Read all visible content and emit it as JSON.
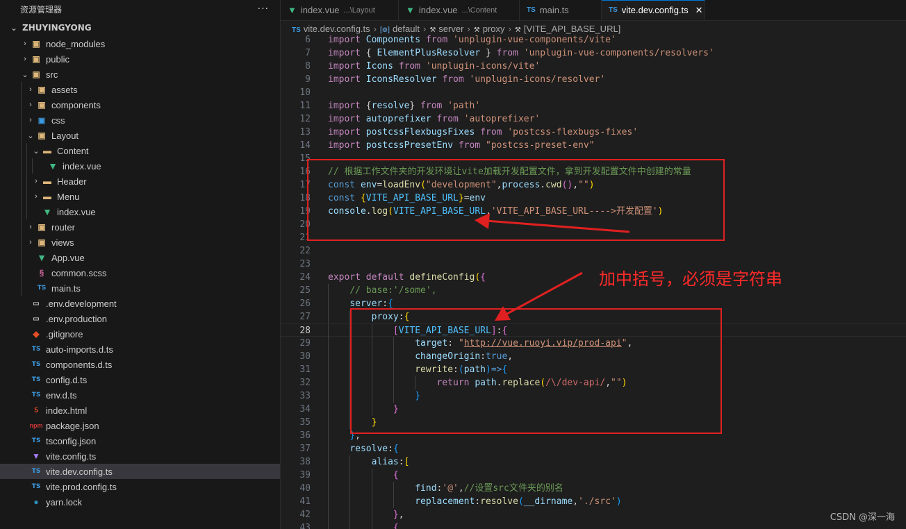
{
  "explorer": {
    "title": "资源管理器",
    "more": "···",
    "root": "ZHUYINGYONG",
    "items": [
      {
        "label": "node_modules",
        "depth": 1,
        "chev": "›",
        "icon": "node-modules-folder-icon",
        "glyph": "▣",
        "kind": "folder"
      },
      {
        "label": "public",
        "depth": 1,
        "chev": "›",
        "icon": "public-folder-icon",
        "glyph": "▣",
        "kind": "folder"
      },
      {
        "label": "src",
        "depth": 1,
        "chev": "⌄",
        "icon": "src-folder-icon",
        "glyph": "▣",
        "kind": "folder"
      },
      {
        "label": "assets",
        "depth": 2,
        "chev": "›",
        "icon": "assets-folder-icon",
        "glyph": "▣",
        "kind": "folder"
      },
      {
        "label": "components",
        "depth": 2,
        "chev": "›",
        "icon": "components-folder-icon",
        "glyph": "▣",
        "kind": "folder"
      },
      {
        "label": "css",
        "depth": 2,
        "chev": "›",
        "icon": "css-folder-icon",
        "glyph": "▣",
        "kind": "css"
      },
      {
        "label": "Layout",
        "depth": 2,
        "chev": "⌄",
        "icon": "layout-folder-icon",
        "glyph": "▣",
        "kind": "folder"
      },
      {
        "label": "Content",
        "depth": 3,
        "chev": "⌄",
        "icon": "content-folder-icon",
        "glyph": "▬",
        "kind": "folder"
      },
      {
        "label": "index.vue",
        "depth": 4,
        "chev": "",
        "icon": "vue-file-icon",
        "glyph": "▼",
        "kind": "vue"
      },
      {
        "label": "Header",
        "depth": 3,
        "chev": "›",
        "icon": "header-folder-icon",
        "glyph": "▬",
        "kind": "folder"
      },
      {
        "label": "Menu",
        "depth": 3,
        "chev": "›",
        "icon": "menu-folder-icon",
        "glyph": "▬",
        "kind": "folder"
      },
      {
        "label": "index.vue",
        "depth": 3,
        "chev": "",
        "icon": "vue-file-icon",
        "glyph": "▼",
        "kind": "vue"
      },
      {
        "label": "router",
        "depth": 2,
        "chev": "›",
        "icon": "router-folder-icon",
        "glyph": "▣",
        "kind": "folder"
      },
      {
        "label": "views",
        "depth": 2,
        "chev": "›",
        "icon": "views-folder-icon",
        "glyph": "▣",
        "kind": "folder"
      },
      {
        "label": "App.vue",
        "depth": 2,
        "chev": "",
        "icon": "vue-file-icon",
        "glyph": "▼",
        "kind": "vue"
      },
      {
        "label": "common.scss",
        "depth": 2,
        "chev": "",
        "icon": "scss-file-icon",
        "glyph": "§",
        "kind": "scss"
      },
      {
        "label": "main.ts",
        "depth": 2,
        "chev": "",
        "icon": "ts-file-icon",
        "glyph": "TS",
        "kind": "ts"
      },
      {
        "label": ".env.development",
        "depth": 1,
        "chev": "",
        "icon": "env-file-icon",
        "glyph": "▭",
        "kind": "env"
      },
      {
        "label": ".env.production",
        "depth": 1,
        "chev": "",
        "icon": "env-file-icon",
        "glyph": "▭",
        "kind": "env"
      },
      {
        "label": ".gitignore",
        "depth": 1,
        "chev": "",
        "icon": "git-file-icon",
        "glyph": "◆",
        "kind": "git"
      },
      {
        "label": "auto-imports.d.ts",
        "depth": 1,
        "chev": "",
        "icon": "ts-file-icon",
        "glyph": "TS",
        "kind": "ts"
      },
      {
        "label": "components.d.ts",
        "depth": 1,
        "chev": "",
        "icon": "ts-file-icon",
        "glyph": "TS",
        "kind": "ts"
      },
      {
        "label": "config.d.ts",
        "depth": 1,
        "chev": "",
        "icon": "ts-file-icon",
        "glyph": "TS",
        "kind": "ts"
      },
      {
        "label": "env.d.ts",
        "depth": 1,
        "chev": "",
        "icon": "ts-file-icon",
        "glyph": "TS",
        "kind": "ts"
      },
      {
        "label": "index.html",
        "depth": 1,
        "chev": "",
        "icon": "html-file-icon",
        "glyph": "5",
        "kind": "html"
      },
      {
        "label": "package.json",
        "depth": 1,
        "chev": "",
        "icon": "npm-file-icon",
        "glyph": "npm",
        "kind": "json"
      },
      {
        "label": "tsconfig.json",
        "depth": 1,
        "chev": "",
        "icon": "tsconfig-file-icon",
        "glyph": "TS",
        "kind": "ts"
      },
      {
        "label": "vite.config.ts",
        "depth": 1,
        "chev": "",
        "icon": "vite-file-icon",
        "glyph": "▼",
        "kind": "vite"
      },
      {
        "label": "vite.dev.config.ts",
        "depth": 1,
        "chev": "",
        "icon": "ts-file-icon",
        "glyph": "TS",
        "kind": "ts",
        "selected": true
      },
      {
        "label": "vite.prod.config.ts",
        "depth": 1,
        "chev": "",
        "icon": "ts-file-icon",
        "glyph": "TS",
        "kind": "ts"
      },
      {
        "label": "yarn.lock",
        "depth": 1,
        "chev": "",
        "icon": "yarn-file-icon",
        "glyph": "●",
        "kind": "yarn"
      }
    ]
  },
  "tabs": [
    {
      "label": "index.vue",
      "desc": "...\\Layout",
      "kind": "vue",
      "glyph": "▼"
    },
    {
      "label": "index.vue",
      "desc": "...\\Content",
      "kind": "vue",
      "glyph": "▼"
    },
    {
      "label": "main.ts",
      "desc": "",
      "kind": "ts",
      "glyph": "TS"
    },
    {
      "label": "vite.dev.config.ts",
      "desc": "",
      "kind": "ts",
      "glyph": "TS",
      "active": true,
      "close": "✕"
    }
  ],
  "breadcrumb": [
    {
      "label": "vite.dev.config.ts",
      "glyph": "TS",
      "kind": "ts"
    },
    {
      "label": "default",
      "glyph": "[⊚]",
      "kind": "sym"
    },
    {
      "label": "server",
      "glyph": "⚒",
      "kind": "wr"
    },
    {
      "label": "proxy",
      "glyph": "⚒",
      "kind": "wr"
    },
    {
      "label": "[VITE_API_BASE_URL]",
      "glyph": "⚒",
      "kind": "wr"
    }
  ],
  "code_lines": [
    {
      "n": 6,
      "t": [
        [
          "kw",
          "import "
        ],
        [
          "var",
          "Components "
        ],
        [
          "kw",
          "from "
        ],
        [
          "str",
          "'unplugin-vue-components/vite'"
        ]
      ]
    },
    {
      "n": 7,
      "t": [
        [
          "kw",
          "import "
        ],
        [
          "pl",
          "{ "
        ],
        [
          "var",
          "ElementPlusResolver "
        ],
        [
          "pl",
          "} "
        ],
        [
          "kw",
          "from "
        ],
        [
          "str",
          "'unplugin-vue-components/resolvers'"
        ]
      ]
    },
    {
      "n": 8,
      "t": [
        [
          "kw",
          "import "
        ],
        [
          "var",
          "Icons "
        ],
        [
          "kw",
          "from "
        ],
        [
          "str",
          "'unplugin-icons/vite'"
        ]
      ]
    },
    {
      "n": 9,
      "t": [
        [
          "kw",
          "import "
        ],
        [
          "var",
          "IconsResolver "
        ],
        [
          "kw",
          "from "
        ],
        [
          "str",
          "'unplugin-icons/resolver'"
        ]
      ]
    },
    {
      "n": 10,
      "t": []
    },
    {
      "n": 11,
      "t": [
        [
          "kw",
          "import "
        ],
        [
          "pl",
          "{"
        ],
        [
          "var",
          "resolve"
        ],
        [
          "pl",
          "} "
        ],
        [
          "kw",
          "from "
        ],
        [
          "str",
          "'path'"
        ]
      ]
    },
    {
      "n": 12,
      "t": [
        [
          "kw",
          "import "
        ],
        [
          "var",
          "autoprefixer "
        ],
        [
          "kw",
          "from "
        ],
        [
          "str",
          "'autoprefixer'"
        ]
      ]
    },
    {
      "n": 13,
      "t": [
        [
          "kw",
          "import "
        ],
        [
          "var",
          "postcssFlexbugsFixes "
        ],
        [
          "kw",
          "from "
        ],
        [
          "str",
          "'postcss-flexbugs-fixes'"
        ]
      ]
    },
    {
      "n": 14,
      "t": [
        [
          "kw",
          "import "
        ],
        [
          "var",
          "postcssPresetEnv "
        ],
        [
          "kw",
          "from "
        ],
        [
          "str",
          "\"postcss-preset-env\""
        ]
      ]
    },
    {
      "n": 15,
      "t": []
    },
    {
      "n": 16,
      "t": [
        [
          "cm",
          "// 根据工作文件夹的开发环境让vite加载开发配置文件，拿到开发配置文件中创建的常量"
        ]
      ]
    },
    {
      "n": 17,
      "t": [
        [
          "dk",
          "const "
        ],
        [
          "var",
          "env"
        ],
        [
          "pl",
          "="
        ],
        [
          "fn",
          "loadEnv"
        ],
        [
          "br1",
          "("
        ],
        [
          "str",
          "\"development\""
        ],
        [
          "pl",
          ","
        ],
        [
          "var",
          "process"
        ],
        [
          "pl",
          "."
        ],
        [
          "fn",
          "cwd"
        ],
        [
          "br2",
          "()"
        ],
        [
          "pl",
          ","
        ],
        [
          "str",
          "\"\""
        ],
        [
          "br1",
          ")"
        ]
      ]
    },
    {
      "n": 18,
      "t": [
        [
          "dk",
          "const "
        ],
        [
          "br1",
          "{"
        ],
        [
          "cn",
          "VITE_API_BASE_URL"
        ],
        [
          "br1",
          "}"
        ],
        [
          "pl",
          "="
        ],
        [
          "var",
          "env"
        ]
      ]
    },
    {
      "n": 19,
      "t": [
        [
          "var",
          "console"
        ],
        [
          "pl",
          "."
        ],
        [
          "fn",
          "log"
        ],
        [
          "br1",
          "("
        ],
        [
          "cn",
          "VITE_API_BASE_URL"
        ],
        [
          "pl",
          ","
        ],
        [
          "str",
          "'VITE_API_BASE_URL---->开发配置'"
        ],
        [
          "br1",
          ")"
        ]
      ]
    },
    {
      "n": 20,
      "t": []
    },
    {
      "n": 21,
      "t": []
    },
    {
      "n": 22,
      "t": []
    },
    {
      "n": 23,
      "t": []
    },
    {
      "n": 24,
      "t": [
        [
          "kw",
          "export "
        ],
        [
          "kw",
          "default "
        ],
        [
          "fn",
          "defineConfig"
        ],
        [
          "br1",
          "("
        ],
        [
          "br2",
          "{"
        ]
      ]
    },
    {
      "n": 25,
      "t": [
        [
          "pl",
          "    "
        ],
        [
          "cm",
          "// base:'/some',"
        ]
      ]
    },
    {
      "n": 26,
      "t": [
        [
          "pl",
          "    "
        ],
        [
          "var",
          "server"
        ],
        [
          "pl",
          ":"
        ],
        [
          "br3",
          "{"
        ]
      ]
    },
    {
      "n": 27,
      "t": [
        [
          "pl",
          "        "
        ],
        [
          "var",
          "proxy"
        ],
        [
          "pl",
          ":"
        ],
        [
          "br1",
          "{"
        ]
      ]
    },
    {
      "n": 28,
      "t": [
        [
          "pl",
          "            "
        ],
        [
          "br2",
          "["
        ],
        [
          "cn",
          "VITE_API_BASE_URL"
        ],
        [
          "br2",
          "]"
        ],
        [
          "pl",
          ":"
        ],
        [
          "br2",
          "{"
        ]
      ],
      "current": true
    },
    {
      "n": 29,
      "t": [
        [
          "pl",
          "                "
        ],
        [
          "var",
          "target"
        ],
        [
          "pl",
          ": "
        ],
        [
          "str",
          "\""
        ],
        [
          "str ul",
          "http://vue.ruoyi.vip/prod-api"
        ],
        [
          "str",
          "\""
        ],
        [
          "pl",
          ","
        ]
      ]
    },
    {
      "n": 30,
      "t": [
        [
          "pl",
          "                "
        ],
        [
          "var",
          "changeOrigin"
        ],
        [
          "pl",
          ":"
        ],
        [
          "dk",
          "true"
        ],
        [
          "pl",
          ","
        ]
      ]
    },
    {
      "n": 31,
      "t": [
        [
          "pl",
          "                "
        ],
        [
          "fn",
          "rewrite"
        ],
        [
          "pl",
          ":"
        ],
        [
          "br3",
          "("
        ],
        [
          "var",
          "path"
        ],
        [
          "br3",
          ")"
        ],
        [
          "dk",
          "=>"
        ],
        [
          "br3",
          "{"
        ]
      ]
    },
    {
      "n": 32,
      "t": [
        [
          "pl",
          "                    "
        ],
        [
          "kw",
          "return "
        ],
        [
          "var",
          "path"
        ],
        [
          "pl",
          "."
        ],
        [
          "fn",
          "replace"
        ],
        [
          "br1",
          "("
        ],
        [
          "rx",
          "/\\/dev-api/"
        ],
        [
          "pl",
          ","
        ],
        [
          "str",
          "\"\""
        ],
        [
          "br1",
          ")"
        ]
      ]
    },
    {
      "n": 33,
      "t": [
        [
          "pl",
          "                "
        ],
        [
          "br3",
          "}"
        ]
      ]
    },
    {
      "n": 34,
      "t": [
        [
          "pl",
          "            "
        ],
        [
          "br2",
          "}"
        ]
      ]
    },
    {
      "n": 35,
      "t": [
        [
          "pl",
          "        "
        ],
        [
          "br1",
          "}"
        ]
      ]
    },
    {
      "n": 36,
      "t": [
        [
          "pl",
          "    "
        ],
        [
          "br3",
          "}"
        ],
        [
          "pl",
          ","
        ]
      ]
    },
    {
      "n": 37,
      "t": [
        [
          "pl",
          "    "
        ],
        [
          "var",
          "resolve"
        ],
        [
          "pl",
          ":"
        ],
        [
          "br3",
          "{"
        ]
      ]
    },
    {
      "n": 38,
      "t": [
        [
          "pl",
          "        "
        ],
        [
          "var",
          "alias"
        ],
        [
          "pl",
          ":"
        ],
        [
          "br1",
          "["
        ]
      ]
    },
    {
      "n": 39,
      "t": [
        [
          "pl",
          "            "
        ],
        [
          "br2",
          "{"
        ]
      ]
    },
    {
      "n": 40,
      "t": [
        [
          "pl",
          "                "
        ],
        [
          "var",
          "find"
        ],
        [
          "pl",
          ":"
        ],
        [
          "str",
          "'@'"
        ],
        [
          "pl",
          ","
        ],
        [
          "cm",
          "//设置src文件夹的别名"
        ]
      ]
    },
    {
      "n": 41,
      "t": [
        [
          "pl",
          "                "
        ],
        [
          "var",
          "replacement"
        ],
        [
          "pl",
          ":"
        ],
        [
          "fn",
          "resolve"
        ],
        [
          "br3",
          "("
        ],
        [
          "var",
          "__dirname"
        ],
        [
          "pl",
          ","
        ],
        [
          "str",
          "'./src'"
        ],
        [
          "br3",
          ")"
        ]
      ]
    },
    {
      "n": 42,
      "t": [
        [
          "pl",
          "            "
        ],
        [
          "br2",
          "}"
        ],
        [
          "pl",
          ","
        ]
      ]
    },
    {
      "n": 43,
      "t": [
        [
          "pl",
          "            "
        ],
        [
          "br2",
          "{"
        ]
      ]
    }
  ],
  "annotation": {
    "note": "加中括号，必须是字符串"
  },
  "watermark": "CSDN @深一海"
}
